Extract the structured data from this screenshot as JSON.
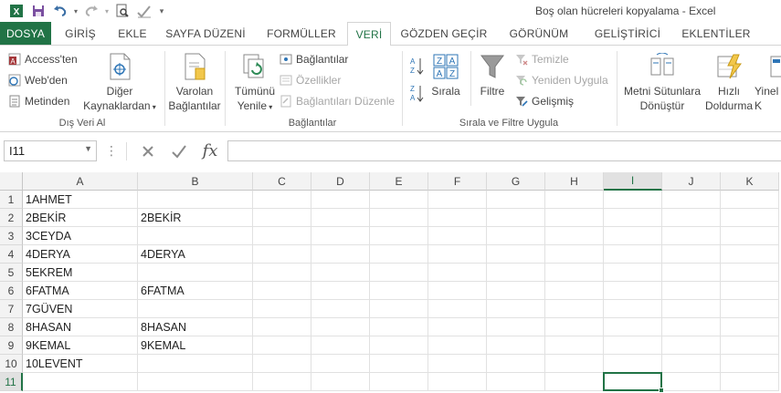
{
  "window": {
    "title": "Boş olan hücreleri kopyalama - Excel"
  },
  "qat": {
    "icons": [
      "excel-logo-icon",
      "save-icon",
      "undo-icon",
      "redo-icon",
      "print-preview-icon",
      "spelling-icon",
      "customize-qat-icon"
    ]
  },
  "ribbon_tabs": [
    {
      "label": "DOSYA",
      "kind": "file"
    },
    {
      "label": "GİRİŞ"
    },
    {
      "label": "EKLE"
    },
    {
      "label": "SAYFA DÜZENİ"
    },
    {
      "label": "FORMÜLLER"
    },
    {
      "label": "VERİ",
      "active": true
    },
    {
      "label": "GÖZDEN GEÇİR"
    },
    {
      "label": "GÖRÜNÜM"
    },
    {
      "label": "GELİŞTİRİCİ"
    },
    {
      "label": "EKLENTİLER"
    }
  ],
  "ribbon": {
    "external_data": {
      "label": "Dış Veri Al",
      "access": "Access'ten",
      "web": "Web'den",
      "text": "Metinden",
      "other_line1": "Diğer",
      "other_line2": "Kaynaklardan",
      "existing_line1": "Varolan",
      "existing_line2": "Bağlantılar"
    },
    "connections": {
      "label": "Bağlantılar",
      "refresh_line1": "Tümünü",
      "refresh_line2": "Yenile",
      "connections": "Bağlantılar",
      "properties": "Özellikler",
      "edit_links": "Bağlantıları Düzenle"
    },
    "sort_filter": {
      "label": "Sırala ve Filtre Uygula",
      "sort": "Sırala",
      "filter": "Filtre",
      "clear": "Temizle",
      "reapply": "Yeniden Uygula",
      "advanced": "Gelişmiş",
      "az": "A Z",
      "za": "Z A"
    },
    "data_tools": {
      "text_to_columns_line1": "Metni Sütunlara",
      "text_to_columns_line2": "Dönüştür",
      "flash_fill_line1": "Hızlı",
      "flash_fill_line2": "Doldurma",
      "remove_dup_line1": "Yinel",
      "remove_dup_line2": "K"
    }
  },
  "formula_bar": {
    "name_box": "I11",
    "formula": "",
    "fx": "fx"
  },
  "sheet": {
    "columns": [
      "A",
      "B",
      "C",
      "D",
      "E",
      "F",
      "G",
      "H",
      "I",
      "J",
      "K"
    ],
    "selected_column": "I",
    "selected_row": "11",
    "rows": [
      {
        "num": "1",
        "A": "1AHMET",
        "B": ""
      },
      {
        "num": "2",
        "A": "2BEKİR",
        "B": "2BEKİR"
      },
      {
        "num": "3",
        "A": "3CEYDA",
        "B": ""
      },
      {
        "num": "4",
        "A": "4DERYA",
        "B": "4DERYA"
      },
      {
        "num": "5",
        "A": "5EKREM",
        "B": ""
      },
      {
        "num": "6",
        "A": "6FATMA",
        "B": "6FATMA"
      },
      {
        "num": "7",
        "A": "7GÜVEN",
        "B": ""
      },
      {
        "num": "8",
        "A": "8HASAN",
        "B": "8HASAN"
      },
      {
        "num": "9",
        "A": "9KEMAL",
        "B": "9KEMAL"
      },
      {
        "num": "10",
        "A": "10LEVENT",
        "B": ""
      },
      {
        "num": "11",
        "A": "",
        "B": ""
      }
    ]
  },
  "colors": {
    "accent": "#217346"
  }
}
